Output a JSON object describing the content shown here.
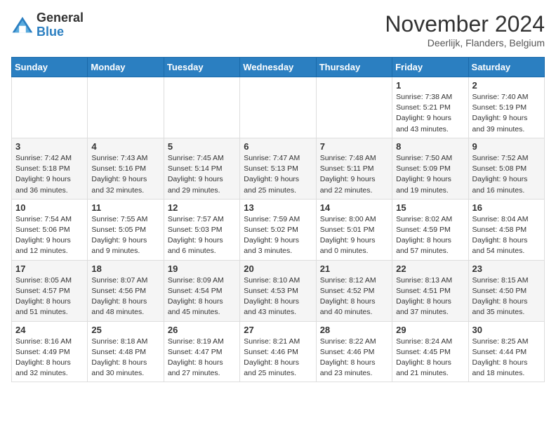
{
  "logo": {
    "general": "General",
    "blue": "Blue"
  },
  "title": "November 2024",
  "location": "Deerlijk, Flanders, Belgium",
  "days_of_week": [
    "Sunday",
    "Monday",
    "Tuesday",
    "Wednesday",
    "Thursday",
    "Friday",
    "Saturday"
  ],
  "weeks": [
    [
      {
        "day": "",
        "info": ""
      },
      {
        "day": "",
        "info": ""
      },
      {
        "day": "",
        "info": ""
      },
      {
        "day": "",
        "info": ""
      },
      {
        "day": "",
        "info": ""
      },
      {
        "day": "1",
        "info": "Sunrise: 7:38 AM\nSunset: 5:21 PM\nDaylight: 9 hours and 43 minutes."
      },
      {
        "day": "2",
        "info": "Sunrise: 7:40 AM\nSunset: 5:19 PM\nDaylight: 9 hours and 39 minutes."
      }
    ],
    [
      {
        "day": "3",
        "info": "Sunrise: 7:42 AM\nSunset: 5:18 PM\nDaylight: 9 hours and 36 minutes."
      },
      {
        "day": "4",
        "info": "Sunrise: 7:43 AM\nSunset: 5:16 PM\nDaylight: 9 hours and 32 minutes."
      },
      {
        "day": "5",
        "info": "Sunrise: 7:45 AM\nSunset: 5:14 PM\nDaylight: 9 hours and 29 minutes."
      },
      {
        "day": "6",
        "info": "Sunrise: 7:47 AM\nSunset: 5:13 PM\nDaylight: 9 hours and 25 minutes."
      },
      {
        "day": "7",
        "info": "Sunrise: 7:48 AM\nSunset: 5:11 PM\nDaylight: 9 hours and 22 minutes."
      },
      {
        "day": "8",
        "info": "Sunrise: 7:50 AM\nSunset: 5:09 PM\nDaylight: 9 hours and 19 minutes."
      },
      {
        "day": "9",
        "info": "Sunrise: 7:52 AM\nSunset: 5:08 PM\nDaylight: 9 hours and 16 minutes."
      }
    ],
    [
      {
        "day": "10",
        "info": "Sunrise: 7:54 AM\nSunset: 5:06 PM\nDaylight: 9 hours and 12 minutes."
      },
      {
        "day": "11",
        "info": "Sunrise: 7:55 AM\nSunset: 5:05 PM\nDaylight: 9 hours and 9 minutes."
      },
      {
        "day": "12",
        "info": "Sunrise: 7:57 AM\nSunset: 5:03 PM\nDaylight: 9 hours and 6 minutes."
      },
      {
        "day": "13",
        "info": "Sunrise: 7:59 AM\nSunset: 5:02 PM\nDaylight: 9 hours and 3 minutes."
      },
      {
        "day": "14",
        "info": "Sunrise: 8:00 AM\nSunset: 5:01 PM\nDaylight: 9 hours and 0 minutes."
      },
      {
        "day": "15",
        "info": "Sunrise: 8:02 AM\nSunset: 4:59 PM\nDaylight: 8 hours and 57 minutes."
      },
      {
        "day": "16",
        "info": "Sunrise: 8:04 AM\nSunset: 4:58 PM\nDaylight: 8 hours and 54 minutes."
      }
    ],
    [
      {
        "day": "17",
        "info": "Sunrise: 8:05 AM\nSunset: 4:57 PM\nDaylight: 8 hours and 51 minutes."
      },
      {
        "day": "18",
        "info": "Sunrise: 8:07 AM\nSunset: 4:56 PM\nDaylight: 8 hours and 48 minutes."
      },
      {
        "day": "19",
        "info": "Sunrise: 8:09 AM\nSunset: 4:54 PM\nDaylight: 8 hours and 45 minutes."
      },
      {
        "day": "20",
        "info": "Sunrise: 8:10 AM\nSunset: 4:53 PM\nDaylight: 8 hours and 43 minutes."
      },
      {
        "day": "21",
        "info": "Sunrise: 8:12 AM\nSunset: 4:52 PM\nDaylight: 8 hours and 40 minutes."
      },
      {
        "day": "22",
        "info": "Sunrise: 8:13 AM\nSunset: 4:51 PM\nDaylight: 8 hours and 37 minutes."
      },
      {
        "day": "23",
        "info": "Sunrise: 8:15 AM\nSunset: 4:50 PM\nDaylight: 8 hours and 35 minutes."
      }
    ],
    [
      {
        "day": "24",
        "info": "Sunrise: 8:16 AM\nSunset: 4:49 PM\nDaylight: 8 hours and 32 minutes."
      },
      {
        "day": "25",
        "info": "Sunrise: 8:18 AM\nSunset: 4:48 PM\nDaylight: 8 hours and 30 minutes."
      },
      {
        "day": "26",
        "info": "Sunrise: 8:19 AM\nSunset: 4:47 PM\nDaylight: 8 hours and 27 minutes."
      },
      {
        "day": "27",
        "info": "Sunrise: 8:21 AM\nSunset: 4:46 PM\nDaylight: 8 hours and 25 minutes."
      },
      {
        "day": "28",
        "info": "Sunrise: 8:22 AM\nSunset: 4:46 PM\nDaylight: 8 hours and 23 minutes."
      },
      {
        "day": "29",
        "info": "Sunrise: 8:24 AM\nSunset: 4:45 PM\nDaylight: 8 hours and 21 minutes."
      },
      {
        "day": "30",
        "info": "Sunrise: 8:25 AM\nSunset: 4:44 PM\nDaylight: 8 hours and 18 minutes."
      }
    ]
  ]
}
